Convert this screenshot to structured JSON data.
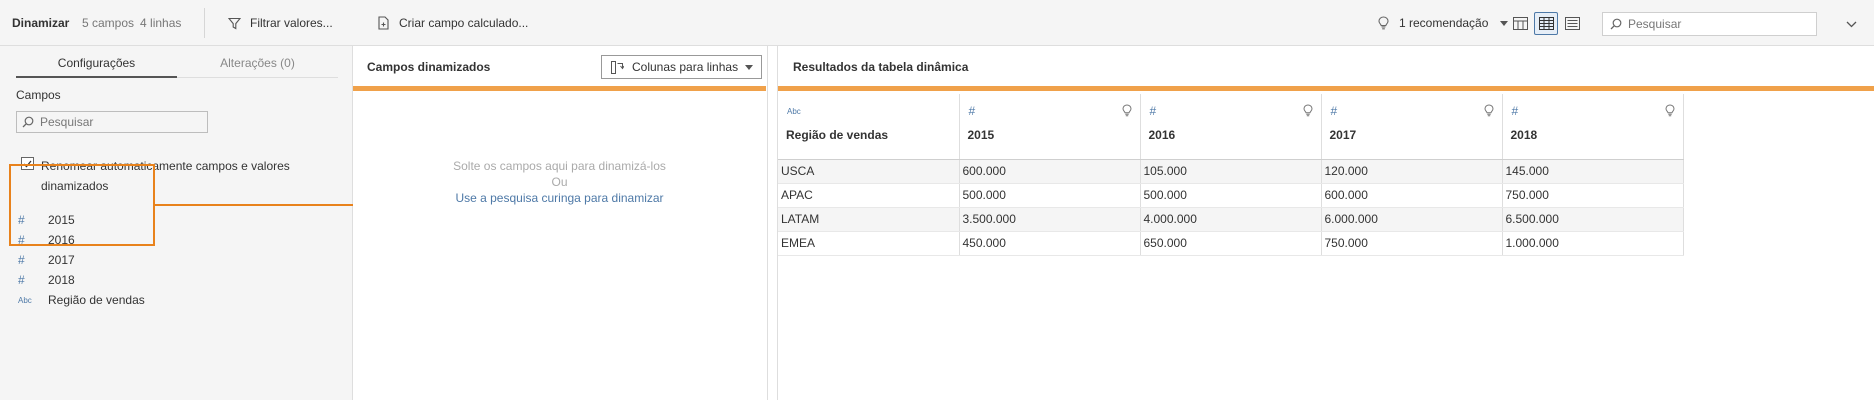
{
  "toolbar": {
    "title": "Dinamizar",
    "field_count": "5 campos",
    "row_count": "4 linhas",
    "filter_label": "Filtrar valores...",
    "calc_label": "Criar campo calculado...",
    "recommendation_label": "1 recomendação",
    "search_placeholder": "Pesquisar"
  },
  "left": {
    "tabs": [
      {
        "label": "Configurações",
        "active": true
      },
      {
        "label": "Alterações (0)",
        "active": false
      }
    ],
    "fields_heading": "Campos",
    "search_placeholder": "Pesquisar",
    "auto_rename": {
      "label": "Renomear automaticamente campos e valores dinamizados",
      "checked": true
    },
    "fields": [
      {
        "icon": "#",
        "label": "2015",
        "type": "number"
      },
      {
        "icon": "#",
        "label": "2016",
        "type": "number"
      },
      {
        "icon": "#",
        "label": "2017",
        "type": "number"
      },
      {
        "icon": "#",
        "label": "2018",
        "type": "number"
      },
      {
        "icon": "Abc",
        "label": "Região de vendas",
        "type": "string"
      }
    ]
  },
  "middle": {
    "title": "Campos dinamizados",
    "dropdown_label": "Colunas para linhas",
    "drop_hint": "Solte os campos aqui para dinamizá-los",
    "or_label": "Ou",
    "wildcard_link": "Use a pesquisa curinga para dinamizar"
  },
  "results": {
    "title": "Resultados da tabela dinâmica",
    "columns": [
      {
        "type_icon": "Abc",
        "name": "Região de vendas",
        "has_bulb": false
      },
      {
        "type_icon": "#",
        "name": "2015",
        "has_bulb": true
      },
      {
        "type_icon": "#",
        "name": "2016",
        "has_bulb": true
      },
      {
        "type_icon": "#",
        "name": "2017",
        "has_bulb": true
      },
      {
        "type_icon": "#",
        "name": "2018",
        "has_bulb": true
      }
    ],
    "rows": [
      [
        "USCA",
        "600.000",
        "105.000",
        "120.000",
        "145.000"
      ],
      [
        "APAC",
        "500.000",
        "500.000",
        "600.000",
        "750.000"
      ],
      [
        "LATAM",
        "3.500.000",
        "4.000.000",
        "6.000.000",
        "6.500.000"
      ],
      [
        "EMEA",
        "450.000",
        "650.000",
        "750.000",
        "1.000.000"
      ]
    ]
  },
  "colors": {
    "accent_orange": "#f0a14a",
    "highlight_orange": "#e8821c",
    "type_icon_blue": "#4e79a7",
    "link_blue": "#4e79a7"
  }
}
